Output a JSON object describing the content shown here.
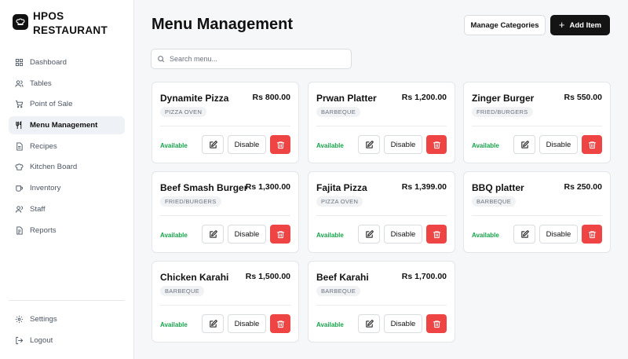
{
  "brand": {
    "line1": "HPOS",
    "line2": "RESTAURANT",
    "logo_icon": "chef-hat-icon"
  },
  "sidebar": {
    "items": [
      {
        "label": "Dashboard",
        "icon": "grid-icon",
        "active": false
      },
      {
        "label": "Tables",
        "icon": "users-icon",
        "active": false
      },
      {
        "label": "Point of Sale",
        "icon": "cart-icon",
        "active": false
      },
      {
        "label": "Menu Management",
        "icon": "utensils-icon",
        "active": true
      },
      {
        "label": "Recipes",
        "icon": "document-icon",
        "active": false
      },
      {
        "label": "Kitchen Board",
        "icon": "chef-hat-icon",
        "active": false
      },
      {
        "label": "Inventory",
        "icon": "cup-icon",
        "active": false
      },
      {
        "label": "Staff",
        "icon": "user-icon",
        "active": false
      },
      {
        "label": "Reports",
        "icon": "report-icon",
        "active": false
      }
    ],
    "bottom": [
      {
        "label": "Settings",
        "icon": "gear-icon"
      },
      {
        "label": "Logout",
        "icon": "logout-icon"
      }
    ]
  },
  "header": {
    "title": "Menu Management",
    "manage_label": "Manage Categories",
    "add_label": "Add Item"
  },
  "search": {
    "placeholder": "Search menu...",
    "value": ""
  },
  "menu_items": [
    {
      "name": "Dynamite Pizza",
      "price": "Rs 800.00",
      "category": "PIZZA OVEN",
      "status": "Available",
      "disable_label": "Disable"
    },
    {
      "name": "Prwan Platter",
      "price": "Rs 1,200.00",
      "category": "BARBEQUE",
      "status": "Available",
      "disable_label": "Disable"
    },
    {
      "name": "Zinger Burger",
      "price": "Rs 550.00",
      "category": "FRIED/BURGERS",
      "status": "Available",
      "disable_label": "Disable"
    },
    {
      "name": "Beef Smash Burger",
      "price": "Rs 1,300.00",
      "category": "FRIED/BURGERS",
      "status": "Available",
      "disable_label": "Disable"
    },
    {
      "name": "Fajita Pizza",
      "price": "Rs 1,399.00",
      "category": "PIZZA OVEN",
      "status": "Available",
      "disable_label": "Disable"
    },
    {
      "name": "BBQ platter",
      "price": "Rs 250.00",
      "category": "BARBEQUE",
      "status": "Available",
      "disable_label": "Disable"
    },
    {
      "name": "Chicken Karahi",
      "price": "Rs 1,500.00",
      "category": "BARBEQUE",
      "status": "Available",
      "disable_label": "Disable"
    },
    {
      "name": "Beef Karahi",
      "price": "Rs 1,700.00",
      "category": "BARBEQUE",
      "status": "Available",
      "disable_label": "Disable"
    }
  ],
  "colors": {
    "accent": "#141414",
    "available": "#16a34a",
    "danger": "#ef4444",
    "active_nav_bg": "#eef1f5"
  }
}
